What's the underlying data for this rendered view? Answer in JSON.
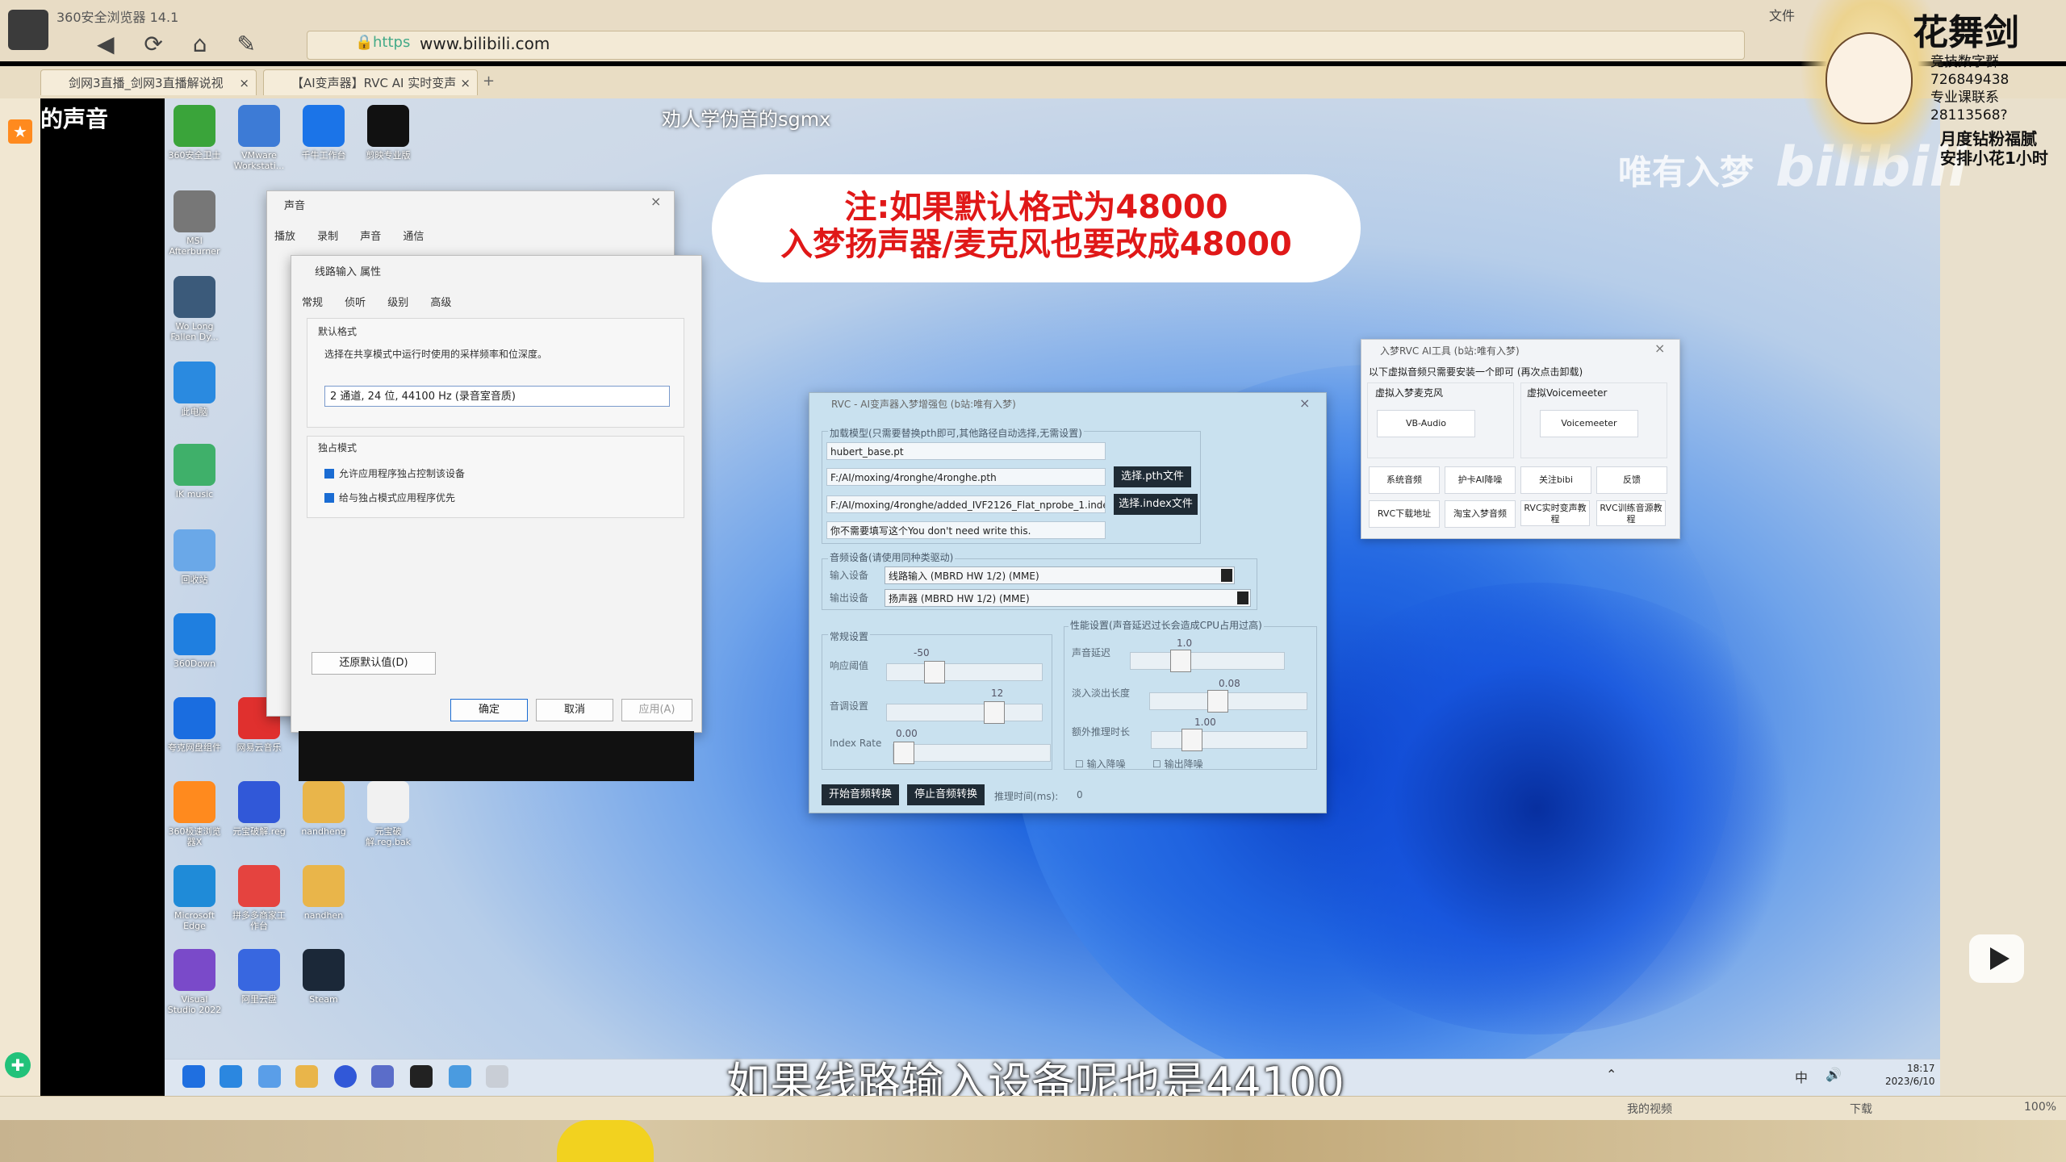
{
  "browser": {
    "title": "360安全浏览器 14.1",
    "url_scheme": "https",
    "url": "www.bilibili.com",
    "menu_file": "文件",
    "tabs": [
      {
        "label": "剑网3直播_剑网3直播解说视"
      },
      {
        "label": "【AI变声器】RVC AI 实时变声"
      }
    ],
    "status": {
      "video": "我的视频",
      "download": "下载",
      "zoom": "100%"
    }
  },
  "video": {
    "side_title": "的声音",
    "top_caption": "劝人学伪音的sgmx",
    "notice_line1": "注:如果默认格式为48000",
    "notice_line2": "入梦扬声器/麦克风也要改成48000",
    "watermark": "唯有入梦",
    "brand": "bilibili",
    "subtitle": "如果线路输入设备呢也是44100"
  },
  "desktop_icons": [
    {
      "label": "360安全卫士",
      "color": "#3aa43a"
    },
    {
      "label": "VMware Workstati...",
      "color": "#3d7bd6"
    },
    {
      "label": "千牛工作台",
      "color": "#1b74e8"
    },
    {
      "label": "剪映专业版",
      "color": "#111111"
    },
    {
      "label": "MSI Afterburner",
      "color": "#777777"
    },
    {
      "label": "Wo Long Fallen Dy...",
      "color": "#3b5a7a"
    },
    {
      "label": "此电脑",
      "color": "#2a8ae0"
    },
    {
      "label": "IK music",
      "color": "#3fb06a"
    },
    {
      "label": "回收站",
      "color": "#6aa8e8"
    },
    {
      "label": "360Down",
      "color": "#1f7fe0"
    },
    {
      "label": "夸克网盘组件",
      "color": "#1a6de0"
    },
    {
      "label": "网易云音乐",
      "color": "#e0302e"
    },
    {
      "label": "360极速浏览器X",
      "color": "#ff8a1e"
    },
    {
      "label": "元宝破解.reg",
      "color": "#3158d8"
    },
    {
      "label": "nandheng",
      "color": "#e9b54a"
    },
    {
      "label": "元宝破解.reg.bak",
      "color": "#f1f1f1"
    },
    {
      "label": "Microsoft Edge",
      "color": "#1f8bd8"
    },
    {
      "label": "拼多多商家工作台",
      "color": "#e5433f"
    },
    {
      "label": "nandhen",
      "color": "#e9b54a"
    },
    {
      "label": "Visual Studio 2022",
      "color": "#7a4ac9"
    },
    {
      "label": "阿里云盘",
      "color": "#3867e0"
    },
    {
      "label": "Steam",
      "color": "#1b2838"
    }
  ],
  "sound_dialog": {
    "title": "声音",
    "tabs": [
      "播放",
      "录制",
      "声音",
      "通信"
    ]
  },
  "line_in_dialog": {
    "title": "线路输入 属性",
    "tabs": [
      "常规",
      "侦听",
      "级别",
      "高级"
    ],
    "default_format_heading": "默认格式",
    "default_format_desc": "选择在共享模式中运行时使用的采样频率和位深度。",
    "format_value": "2 通道, 24 位, 44100 Hz (录音室音质)",
    "exclusive_heading": "独占模式",
    "check1": "允许应用程序独占控制该设备",
    "check2": "给与独占模式应用程序优先",
    "restore_button": "还原默认值(D)",
    "ok_button": "确定",
    "cancel_button": "取消",
    "apply_button": "应用(A)"
  },
  "rvc": {
    "title": "RVC - AI变声器入梦增强包 (b站:唯有入梦)",
    "model_legend": "加载模型(只需要替换pth即可,其他路径自动选择,无需设置)",
    "hubert": "hubert_base.pt",
    "pth_path": "F:/AI/moxing/4ronghe/4ronghe.pth",
    "index_path": "F:/AI/moxing/4ronghe/added_IVF2126_Flat_nprobe_1.index",
    "note": "你不需要填写这个You don't need write this.",
    "select_pth": "选择.pth文件",
    "select_index": "选择.index文件",
    "audio_legend": "音频设备(请使用同种类驱动)",
    "input_label": "输入设备",
    "input_value": "线路输入 (MBRD HW 1/2) (MME)",
    "output_label": "输出设备",
    "output_value": "扬声器 (MBRD HW 1/2) (MME)",
    "general_legend": "常规设置",
    "threshold_label": "响应阈值",
    "threshold_value": "-50",
    "threshold_pct": 0.28,
    "pitch_label": "音调设置",
    "pitch_value": "12",
    "pitch_pct": 0.72,
    "index_rate_label": "Index Rate",
    "index_rate_value": "0.00",
    "index_rate_pct": 0.0,
    "perf_legend": "性能设置(声音延迟过长会造成CPU占用过高)",
    "delay_label": "声音延迟",
    "delay_value": "1.0",
    "delay_pct": 0.3,
    "fade_label": "淡入淡出长度",
    "fade_value": "0.08",
    "fade_pct": 0.42,
    "extra_label": "额外推理时长",
    "extra_value": "1.00",
    "extra_pct": 0.22,
    "in_denoise": "输入降噪",
    "out_denoise": "输出降噪",
    "start_button": "开始音频转换",
    "stop_button": "停止音频转换",
    "infer_time_label": "推理时间(ms):",
    "infer_time_value": "0"
  },
  "tools": {
    "title": "入梦RVC AI工具 (b站:唯有入梦)",
    "desc": "以下虚拟音频只需要安装一个即可 (再次点击卸载)",
    "group1": "虚拟入梦麦克风",
    "group2": "虚拟Voicemeeter",
    "vb_audio": "VB-Audio",
    "voicemeeter": "Voicemeeter",
    "row1": [
      "系统音频",
      "护卡AI降噪",
      "关注bibi",
      "反馈"
    ],
    "row2": [
      "RVC下载地址",
      "淘宝入梦音频",
      "RVC实时变声教程",
      "RVC训练音源教程"
    ]
  },
  "taskbar": {
    "time": "18:17",
    "date": "2023/6/10",
    "ime": "中"
  },
  "overlay": {
    "name": "花舞剑",
    "line1": "竞技数字群",
    "line2": "726849438",
    "line3": "专业课联系",
    "line4": "28113568?",
    "promo1": "月度钻粉福腻",
    "promo2": "安排小花1小时"
  }
}
